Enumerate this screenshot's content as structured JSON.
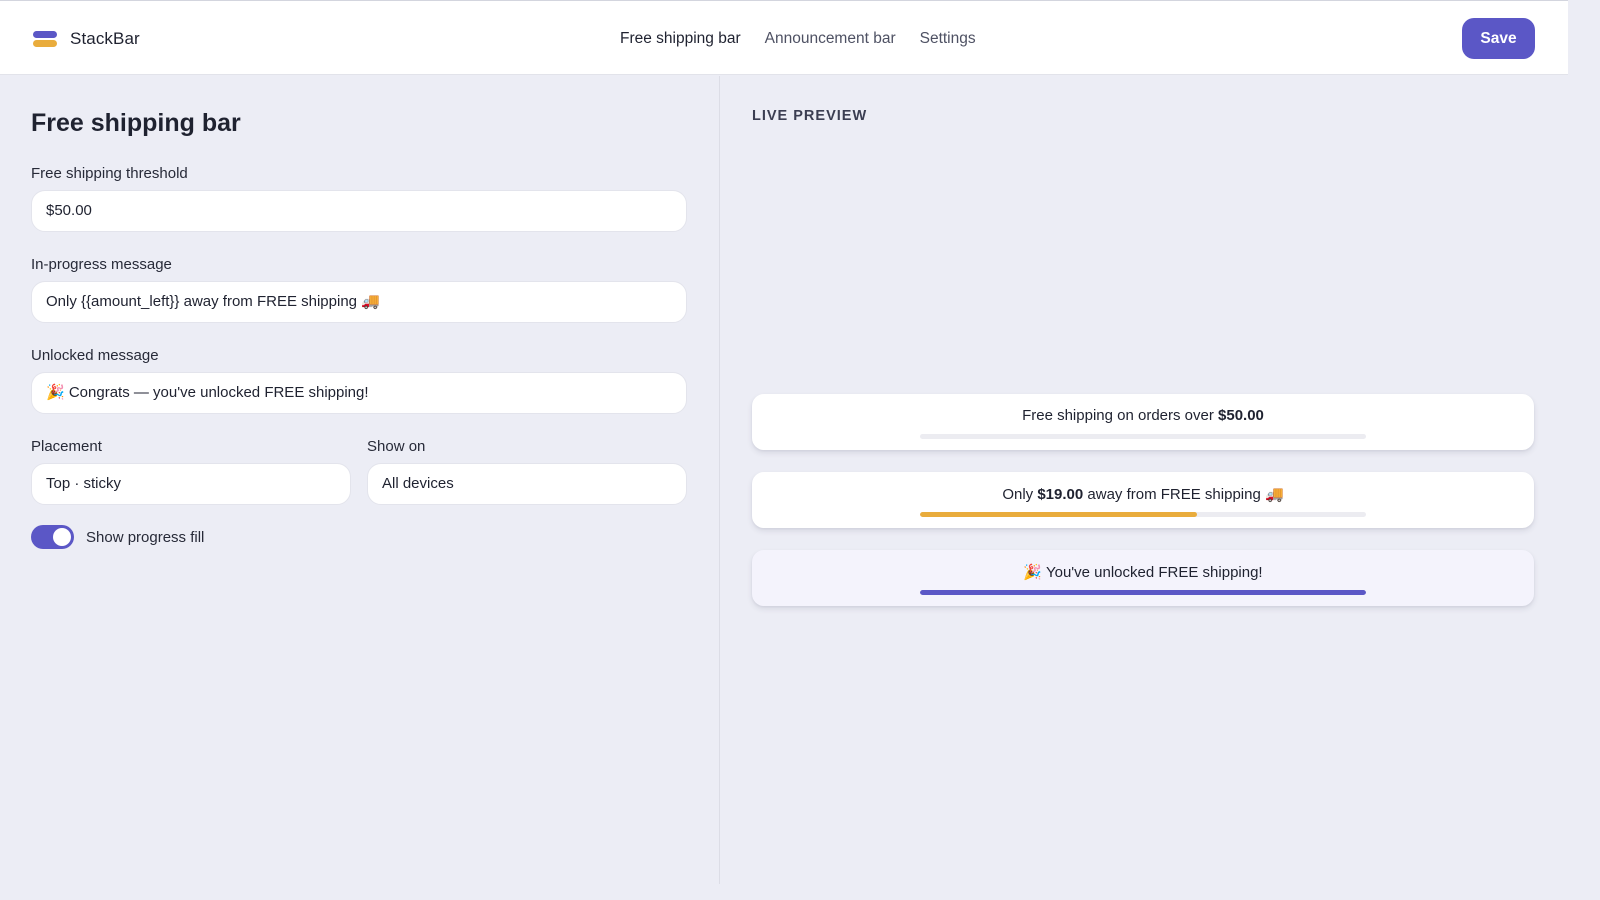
{
  "app": {
    "brand": "StackBar",
    "nav": [
      "Free shipping bar",
      "Announcement bar",
      "Settings"
    ],
    "active_nav": "Free shipping bar",
    "save_label": "Save"
  },
  "form": {
    "title": "Free shipping bar",
    "threshold_label": "Free shipping threshold",
    "threshold_value": "$50.00",
    "progress_label": "In-progress message",
    "progress_value": "Only {{amount_left}} away from FREE shipping 🚚",
    "unlocked_label": "Unlocked message",
    "unlocked_value": "🎉 Congrats — you've unlocked FREE shipping!",
    "placement_label": "Placement",
    "placement_value": "Top · sticky",
    "showon_label": "Show on",
    "showon_value": "All devices",
    "toggle_label": "Show progress fill",
    "toggle_on": true
  },
  "preview": {
    "label": "LIVE PREVIEW",
    "cards": [
      {
        "pre": "Free shipping on orders over ",
        "amount": "$50.00",
        "post": "",
        "progress": 0,
        "fill_color": "#e9ac3c"
      },
      {
        "pre": "Only ",
        "amount": "$19.00",
        "post": " away from FREE shipping 🚚",
        "progress": 0.62,
        "fill_color": "#e9ac3c"
      },
      {
        "pre": "🎉 You've unlocked FREE shipping!",
        "amount": "",
        "post": "",
        "progress": 1.0,
        "fill_color": "#5b57c6"
      }
    ]
  },
  "colors": {
    "accent": "#5b57c6",
    "progress": "#e9ac3c",
    "background": "#ecedf5"
  }
}
